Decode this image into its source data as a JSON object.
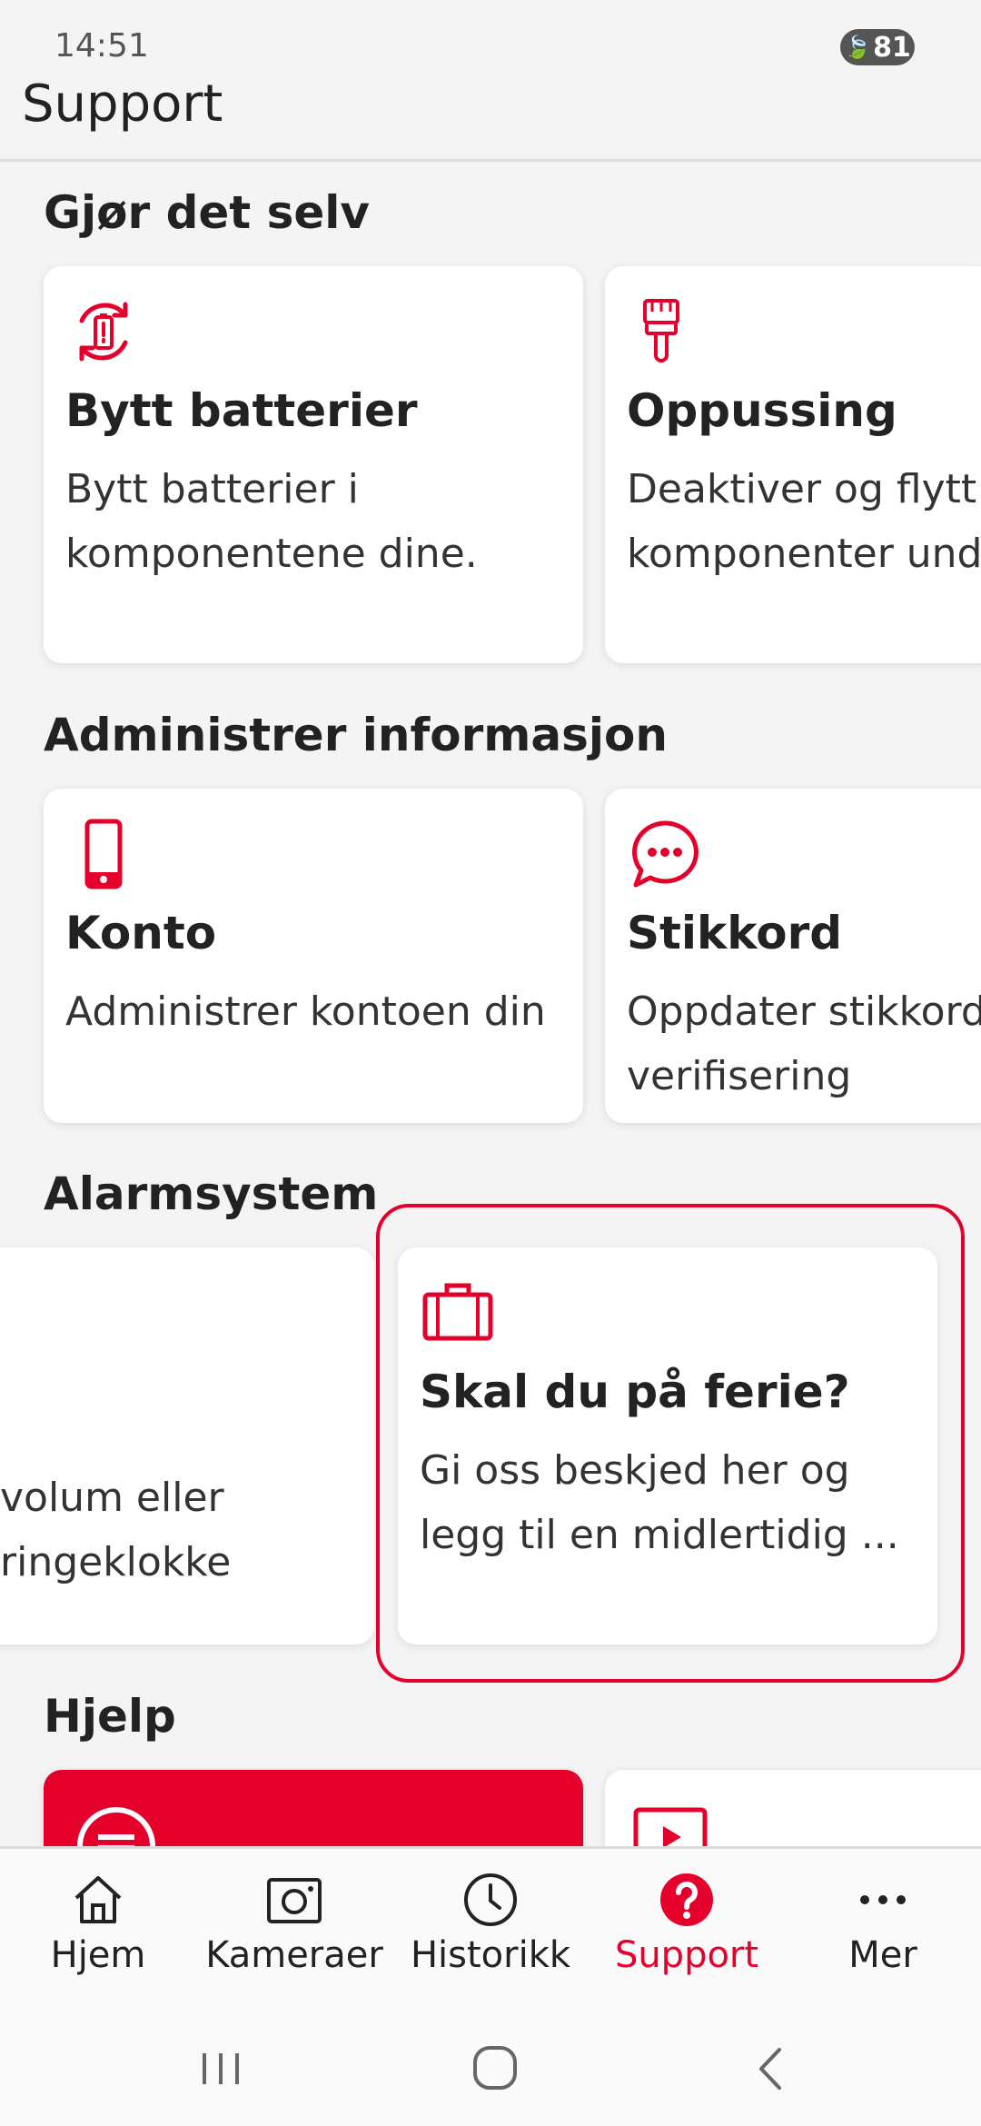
{
  "status": {
    "time": "14:51",
    "battery": "81"
  },
  "header": {
    "title": "Support"
  },
  "sections": {
    "diy": {
      "title": "Gjør det selv",
      "cards": [
        {
          "title": "Bytt batterier",
          "desc": "Bytt batterier i\nkomponentene dine.",
          "icon": "battery-swap-icon"
        },
        {
          "title": "Oppussing",
          "desc": "Deaktiver og flytt\nkomponenter und",
          "icon": "paintbrush-icon"
        }
      ]
    },
    "info": {
      "title": "Administrer informasjon",
      "cards": [
        {
          "title": "Konto",
          "desc": "Administrer kontoen din",
          "icon": "phone-icon"
        },
        {
          "title": "Stikkord",
          "desc": "Oppdater stikkord\nverifisering",
          "icon": "chat-bubble-icon"
        }
      ]
    },
    "alarm": {
      "title": "Alarmsystem",
      "cards": [
        {
          "title": "",
          "desc": "volum eller\n ringeklokke",
          "icon": ""
        },
        {
          "title": "Skal du på ferie?",
          "desc": "Gi oss beskjed her og\nlegg til en midlertidig ...",
          "icon": "suitcase-icon"
        }
      ]
    },
    "help": {
      "title": "Hjelp"
    }
  },
  "bottom_nav": [
    {
      "label": "Hjem",
      "icon": "home-icon"
    },
    {
      "label": "Kameraer",
      "icon": "camera-icon"
    },
    {
      "label": "Historikk",
      "icon": "clock-icon"
    },
    {
      "label": "Support",
      "icon": "help-icon",
      "active": true
    },
    {
      "label": "Mer",
      "icon": "more-icon"
    }
  ],
  "colors": {
    "accent": "#e4002b",
    "background": "#f4f4f4",
    "card": "#ffffff"
  }
}
